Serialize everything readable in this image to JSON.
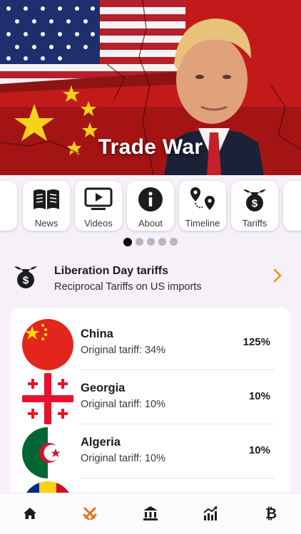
{
  "hero": {
    "title": "Trade War"
  },
  "categories": [
    {
      "label": "News",
      "icon": "book-icon"
    },
    {
      "label": "Videos",
      "icon": "video-icon"
    },
    {
      "label": "About",
      "icon": "info-icon"
    },
    {
      "label": "Timeline",
      "icon": "map-pin-icon"
    },
    {
      "label": "Tariffs",
      "icon": "money-bag-icon"
    }
  ],
  "pager": {
    "count": 5,
    "active": 0
  },
  "liberation": {
    "title": "Liberation Day tariffs",
    "subtitle": "Reciprocal Tariffs on US imports",
    "icon": "money-bag-icon",
    "chevron_color": "#e8901c"
  },
  "countries": [
    {
      "name": "China",
      "original": "Original tariff: 34%",
      "rate": "125%"
    },
    {
      "name": "Georgia",
      "original": "Original tariff: 10%",
      "rate": "10%"
    },
    {
      "name": "Algeria",
      "original": "Original tariff: 10%",
      "rate": "10%"
    }
  ],
  "tabbar": {
    "items": [
      "home-icon",
      "crossed-swords-icon",
      "bank-icon",
      "chart-icon",
      "bitcoin-icon"
    ],
    "active": 1,
    "active_color": "#e8701c"
  }
}
